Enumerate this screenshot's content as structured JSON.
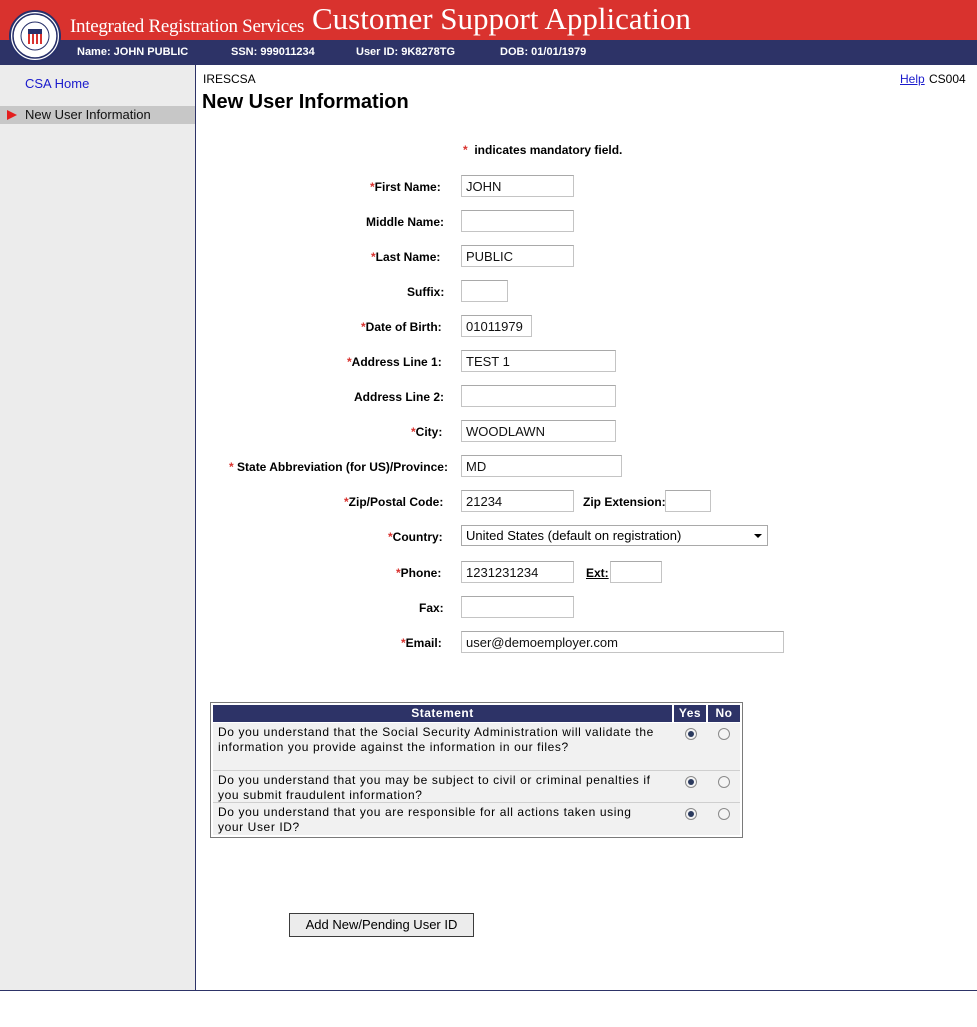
{
  "header": {
    "brand": "Integrated Registration Services",
    "app_title": "Customer Support Application",
    "user_name": "Name: JOHN PUBLIC",
    "ssn": "SSN: 999011234",
    "user_id": "User ID: 9K8278TG",
    "dob": "DOB: 01/01/1979",
    "colors": {
      "red_band": "#d9322e",
      "navy_bar": "#2d3367"
    }
  },
  "sidebar": {
    "items": [
      {
        "label": "CSA Home",
        "active": false
      },
      {
        "label": "New User Information",
        "active": true
      }
    ]
  },
  "page": {
    "breadcrumb": "IRESCSA",
    "help_link": "Help",
    "page_code": "CS004",
    "title": "New User Information",
    "mandatory_note": "indicates mandatory field."
  },
  "form": {
    "first_name": {
      "label": "First Name:",
      "value": "JOHN",
      "required": true
    },
    "middle_name": {
      "label": "Middle Name:",
      "value": "",
      "required": false
    },
    "last_name": {
      "label": "Last Name:",
      "value": "PUBLIC",
      "required": true
    },
    "suffix": {
      "label": "Suffix:",
      "value": "",
      "required": false
    },
    "dob": {
      "label": "Date of Birth:",
      "value": "01011979",
      "required": true
    },
    "address1": {
      "label": "Address Line 1:",
      "value": "TEST 1",
      "required": true
    },
    "address2": {
      "label": "Address Line 2:",
      "value": "",
      "required": false
    },
    "city": {
      "label": "City:",
      "value": "WOODLAWN",
      "required": true
    },
    "state": {
      "label": "State Abbreviation (for US)/Province:",
      "value": "MD",
      "required": true
    },
    "zip": {
      "label": "Zip/Postal Code:",
      "value": "21234",
      "required": true
    },
    "zip_ext": {
      "label": "Zip Extension:",
      "value": ""
    },
    "country": {
      "label": "Country:",
      "value": "United States (default on registration)",
      "required": true
    },
    "phone": {
      "label": "Phone:",
      "value": "1231231234",
      "required": true
    },
    "phone_ext": {
      "label": "Ext:",
      "value": ""
    },
    "fax": {
      "label": "Fax:",
      "value": "",
      "required": false
    },
    "email": {
      "label": "Email:",
      "value": "user@demoemployer.com",
      "required": true
    }
  },
  "statements": {
    "headers": {
      "statement": "Statement",
      "yes": "Yes",
      "no": "No"
    },
    "rows": [
      {
        "text": "Do you understand that the Social Security Administration will validate the information you provide against the information in our files?",
        "answer": "yes"
      },
      {
        "text": "Do you understand that you may be subject to civil or criminal penalties if you submit fraudulent information?",
        "answer": "yes"
      },
      {
        "text": "Do you understand that you are responsible for all actions taken using your User ID?",
        "answer": "yes"
      }
    ]
  },
  "actions": {
    "submit_label": "Add New/Pending User ID"
  }
}
